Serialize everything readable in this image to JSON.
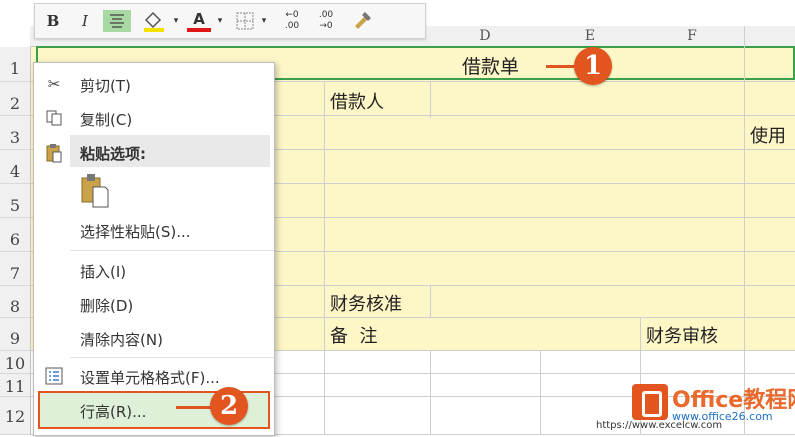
{
  "toolbar": {
    "bold": "B",
    "italic": "I",
    "font_color_glyph": "A",
    "increase_decimal": ".00",
    "decrease_decimal": ".00"
  },
  "columns": [
    "D",
    "E",
    "F"
  ],
  "rows": [
    "1",
    "2",
    "3",
    "4",
    "5",
    "6",
    "7",
    "8",
    "9",
    "10",
    "11",
    "12"
  ],
  "cells": {
    "title": "借款单",
    "borrower": "借款人",
    "usage": "使用",
    "finance_check": "财务核准",
    "remarks": "备  注",
    "finance_audit": "财务审核"
  },
  "context_menu": {
    "cut": "剪切(T)",
    "copy": "复制(C)",
    "paste_options": "粘贴选项:",
    "paste_special": "选择性粘贴(S)...",
    "insert": "插入(I)",
    "delete": "删除(D)",
    "clear_contents": "清除内容(N)",
    "format_cells": "设置单元格格式(F)...",
    "row_height": "行高(R)..."
  },
  "callouts": {
    "one": "1",
    "two": "2"
  },
  "watermark": {
    "title": "Office教程网",
    "url": "www.office26.com",
    "url2": "https://www.excelcw.com"
  },
  "colors": {
    "accent": "#e2551e",
    "cell_fill": "#fdf6c6",
    "menu_highlight": "#dff0d8"
  }
}
